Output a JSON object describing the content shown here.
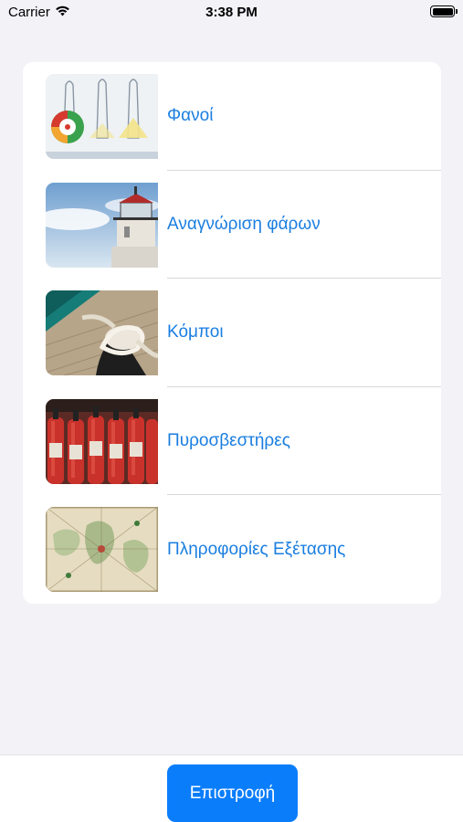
{
  "status_bar": {
    "carrier": "Carrier",
    "time": "3:38 PM",
    "icons": [
      "wifi-icon",
      "battery-icon"
    ]
  },
  "menu": {
    "items": [
      {
        "label": "Φανοί",
        "image": "ship-lights-diagram"
      },
      {
        "label": "Αναγνώριση φάρων",
        "image": "lighthouse-photo"
      },
      {
        "label": "Κόμποι",
        "image": "rope-knot-photo"
      },
      {
        "label": "Πυροσβεστήρες",
        "image": "fire-extinguishers-photo"
      },
      {
        "label": "Πληροφορίες Εξέτασης",
        "image": "old-map-photo"
      }
    ]
  },
  "toolbar": {
    "back_label": "Επιστροφή"
  },
  "colors": {
    "background": "#f2f2f7",
    "link": "#1a7ee0",
    "button": "#0a7dfb"
  }
}
